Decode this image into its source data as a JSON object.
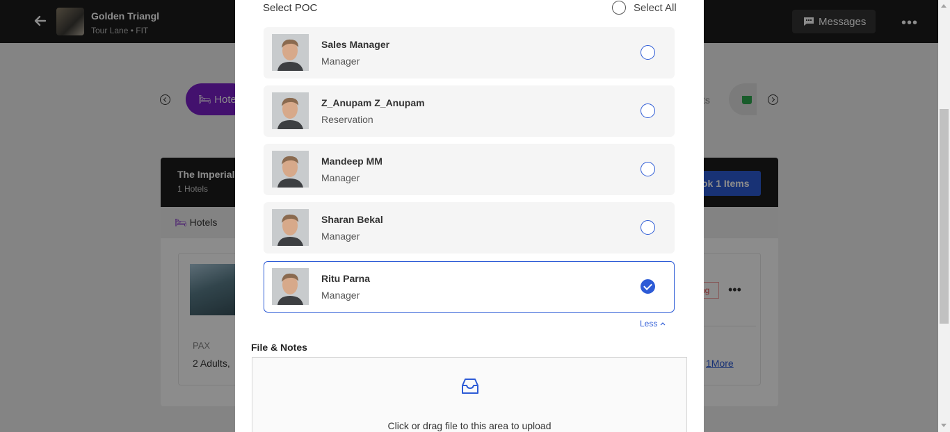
{
  "background": {
    "trip": {
      "title": "Golden Triangl",
      "subtitle": "Tour Lane • FIT"
    },
    "messages_label": "Messages",
    "active_tab_label": "Hote",
    "partial_tab_label": "ts",
    "card": {
      "title": "The Imperial,",
      "subtitle": "1 Hotels",
      "book_label": "ok 1 Items",
      "tab_label": "Hotels",
      "status_tag": "ng",
      "pax_label": "PAX",
      "pax_value": "2 Adults,",
      "more_link": "1More"
    }
  },
  "modal": {
    "section_title": "Select POC",
    "select_all_label": "Select All",
    "pocs": [
      {
        "name": "Sales Manager",
        "role": "Manager",
        "selected": false
      },
      {
        "name": "Z_Anupam Z_Anupam",
        "role": "Reservation",
        "selected": false
      },
      {
        "name": "Mandeep MM",
        "role": "Manager",
        "selected": false
      },
      {
        "name": "Sharan Bekal",
        "role": "Manager",
        "selected": false
      },
      {
        "name": "Ritu Parna",
        "role": "Manager",
        "selected": true
      }
    ],
    "less_label": "Less",
    "file_notes_title": "File & Notes",
    "upload_text": "Click or drag file to this area to upload"
  },
  "icons": {
    "back": "arrow-left-icon",
    "messages": "chat-icon",
    "more": "more-horizontal-icon",
    "hotel": "bed-icon",
    "basket": "basket-icon",
    "upload": "inbox-icon",
    "less": "chevron-up-icon"
  },
  "colors": {
    "accent_blue": "#2d5bd6",
    "hotel_tab_purple": "#7b1fc9",
    "topbar": "#1d1d1d"
  }
}
